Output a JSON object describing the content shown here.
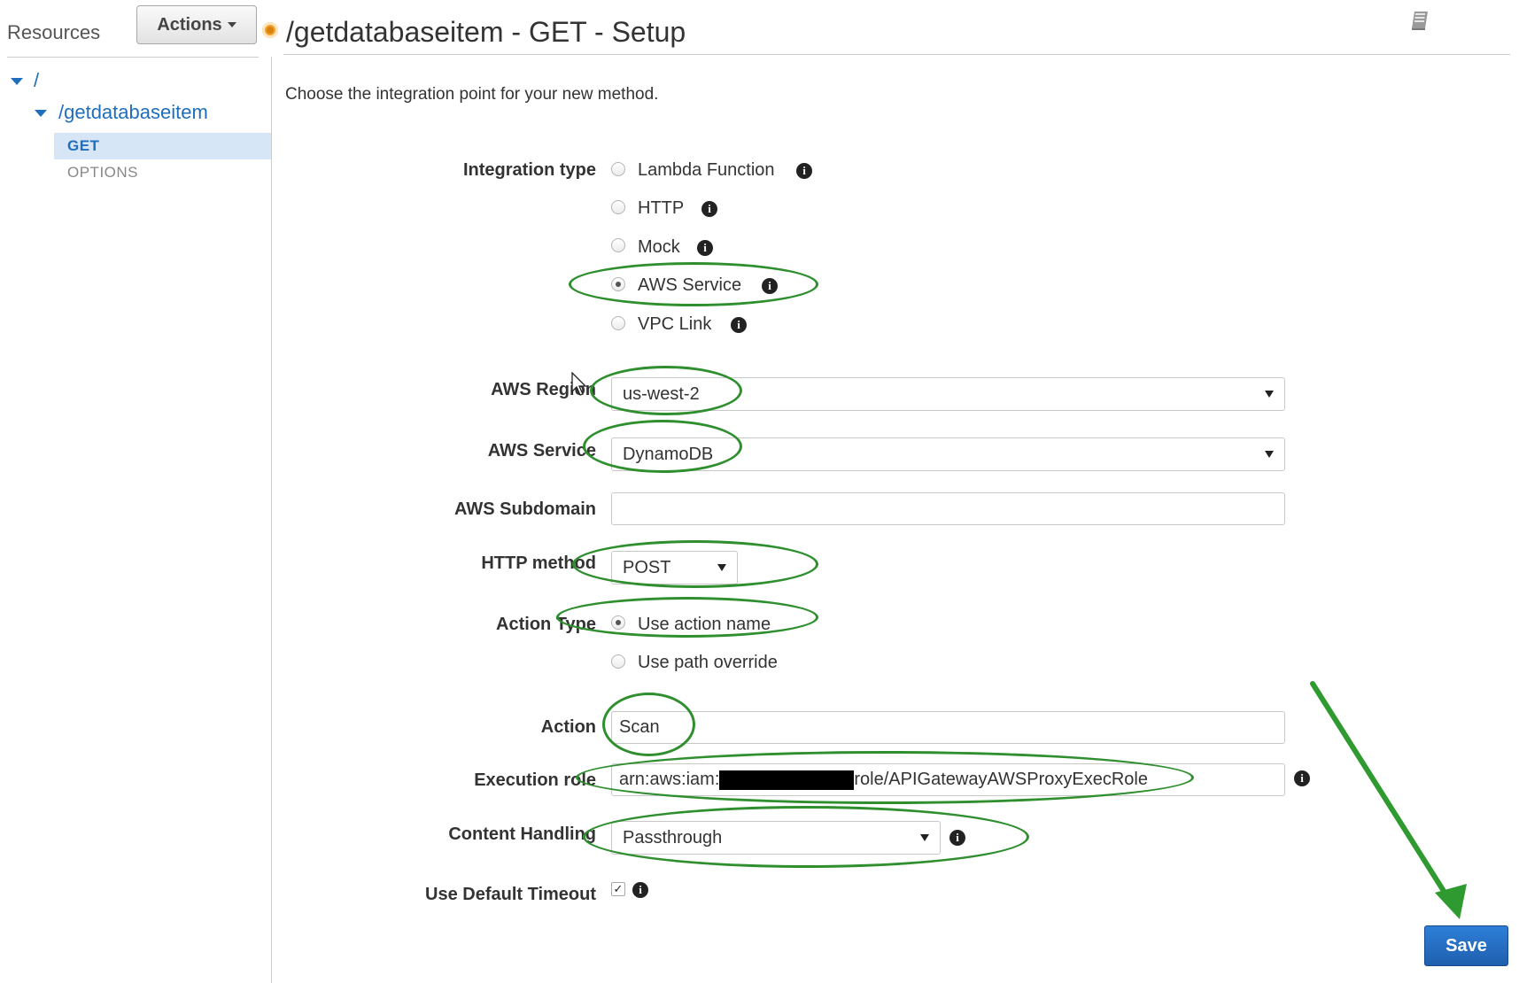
{
  "sidebar": {
    "title": "Resources",
    "actions_label": "Actions",
    "tree": {
      "root": "/",
      "resource": "/getdatabaseitem",
      "methods": [
        "GET",
        "OPTIONS"
      ]
    }
  },
  "header": {
    "title": "/getdatabaseitem - GET - Setup",
    "intro": "Choose the integration point for your new method."
  },
  "form": {
    "integration_type": {
      "label": "Integration type",
      "options": [
        "Lambda Function",
        "HTTP",
        "Mock",
        "AWS Service",
        "VPC Link"
      ],
      "selected": "AWS Service"
    },
    "aws_region": {
      "label": "AWS Region",
      "value": "us-west-2"
    },
    "aws_service": {
      "label": "AWS Service",
      "value": "DynamoDB"
    },
    "aws_subdomain": {
      "label": "AWS Subdomain",
      "value": ""
    },
    "http_method": {
      "label": "HTTP method",
      "value": "POST"
    },
    "action_type": {
      "label": "Action Type",
      "options": [
        "Use action name",
        "Use path override"
      ],
      "selected": "Use action name"
    },
    "action": {
      "label": "Action",
      "value": "Scan"
    },
    "execution_role": {
      "label": "Execution role",
      "prefix": "arn:aws:iam:",
      "suffix": "role/APIGatewayAWSProxyExecRole"
    },
    "content_handling": {
      "label": "Content Handling",
      "value": "Passthrough"
    },
    "use_default_timeout": {
      "label": "Use Default Timeout",
      "checked": true
    }
  },
  "save_label": "Save",
  "annotation_color": "#2f8f2f",
  "accent_color": "#1f6ebd"
}
